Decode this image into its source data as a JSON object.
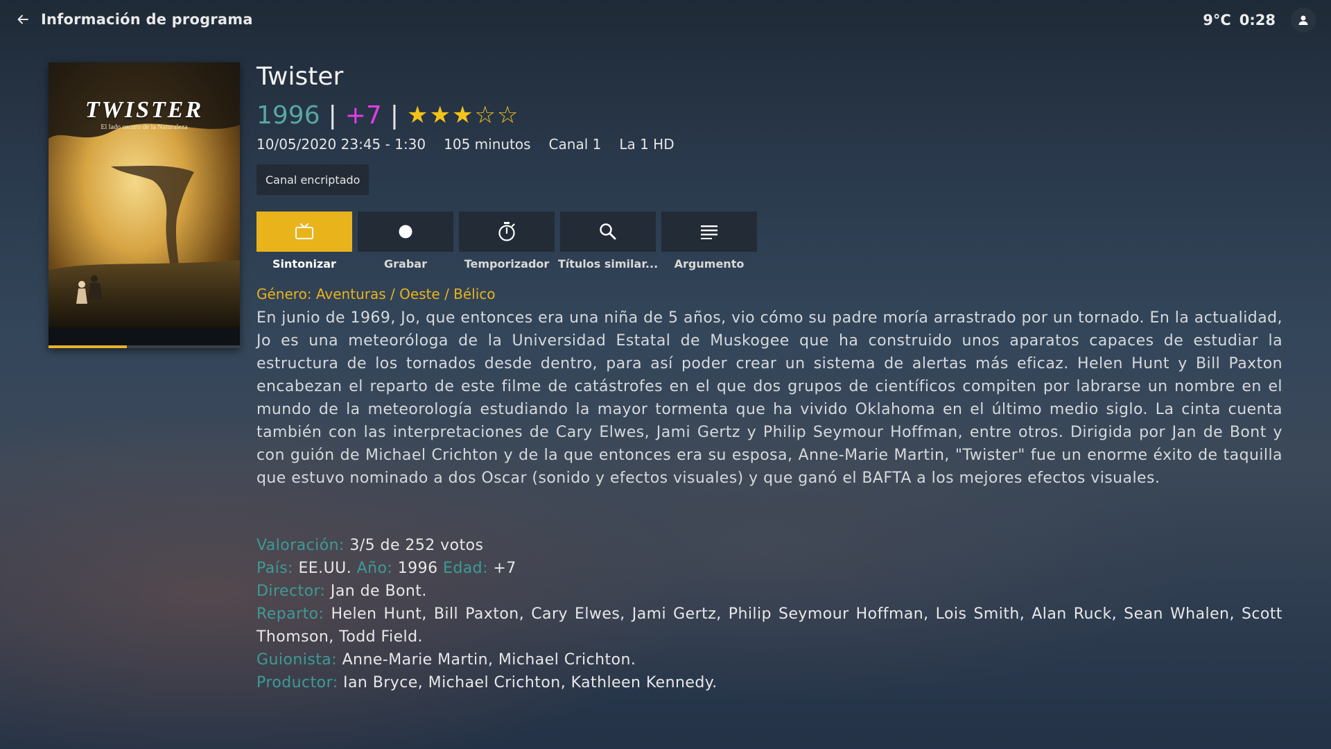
{
  "header": {
    "title": "Información de programa",
    "temperature": "9°C",
    "time": "0:28"
  },
  "poster": {
    "title": "TWISTER",
    "tagline": "El lado oscuro de la Naturaleza",
    "progress": 0.41
  },
  "program": {
    "title": "Twister",
    "year": "1996",
    "age_rating": "+7",
    "rating_stars": 3,
    "rating_max": 5,
    "datetime": "10/05/2020 23:45 - 1:30",
    "duration": "105 minutos",
    "channel": "Canal 1",
    "channel_name": "La 1 HD",
    "badge": "Canal encriptado",
    "genre": "Género: Aventuras / Oeste / Bélico",
    "synopsis": "En junio de 1969, Jo, que entonces era una niña de 5 años, vio cómo su padre moría arrastrado por un tornado. En la actualidad, Jo es una meteoróloga de la Universidad Estatal de Muskogee que ha construido unos aparatos capaces de estudiar la estructura de los tornados desde dentro, para así poder crear un sistema de alertas más eficaz. Helen Hunt y Bill Paxton encabezan el reparto de este filme de catástrofes en el que dos grupos de científicos compiten por labrarse un nombre en el mundo de la meteorología estudiando la mayor tormenta que ha vivido Oklahoma en el último medio siglo. La cinta cuenta también con las interpretaciones de Cary Elwes, Jami Gertz y Philip Seymour Hoffman, entre otros. Dirigida por Jan de Bont y con guión de Michael Crichton y de la que entonces era su esposa, Anne-Marie Martin, \"Twister\" fue un enorme éxito de taquilla que estuvo nominado a dos Oscar (sonido y efectos visuales) y que ganó el BAFTA a los mejores efectos visuales."
  },
  "actions": [
    {
      "label": "Sintonizar",
      "icon": "tv-icon",
      "active": true
    },
    {
      "label": "Grabar",
      "icon": "record-icon",
      "active": false
    },
    {
      "label": "Temporizador",
      "icon": "timer-icon",
      "active": false
    },
    {
      "label": "Títulos similar...",
      "icon": "search-icon",
      "active": false
    },
    {
      "label": "Argumento",
      "icon": "text-lines-icon",
      "active": false
    }
  ],
  "details": {
    "rating_label": "Valoración:",
    "rating_value": "3/5 de 252 votos",
    "country_label": "País:",
    "country_value": "EE.UU.",
    "year_label": "Año:",
    "year_value": "1996",
    "age_label": "Edad:",
    "age_value": "+7",
    "director_label": "Director:",
    "director_value": "Jan de Bont.",
    "cast_label": "Reparto:",
    "cast_value": "Helen Hunt, Bill Paxton, Cary Elwes, Jami Gertz, Philip Seymour Hoffman, Lois Smith, Alan Ruck, Sean Whalen, Scott Thomson, Todd Field.",
    "writer_label": "Guionista:",
    "writer_value": "Anne-Marie Martin, Michael Crichton.",
    "producer_label": "Productor:",
    "producer_value": "Ian Bryce, Michael Crichton, Kathleen Kennedy."
  },
  "colors": {
    "accent": "#e9b31b",
    "year": "#58a7a3",
    "age": "#e33ce7",
    "label": "#3d9b97"
  }
}
